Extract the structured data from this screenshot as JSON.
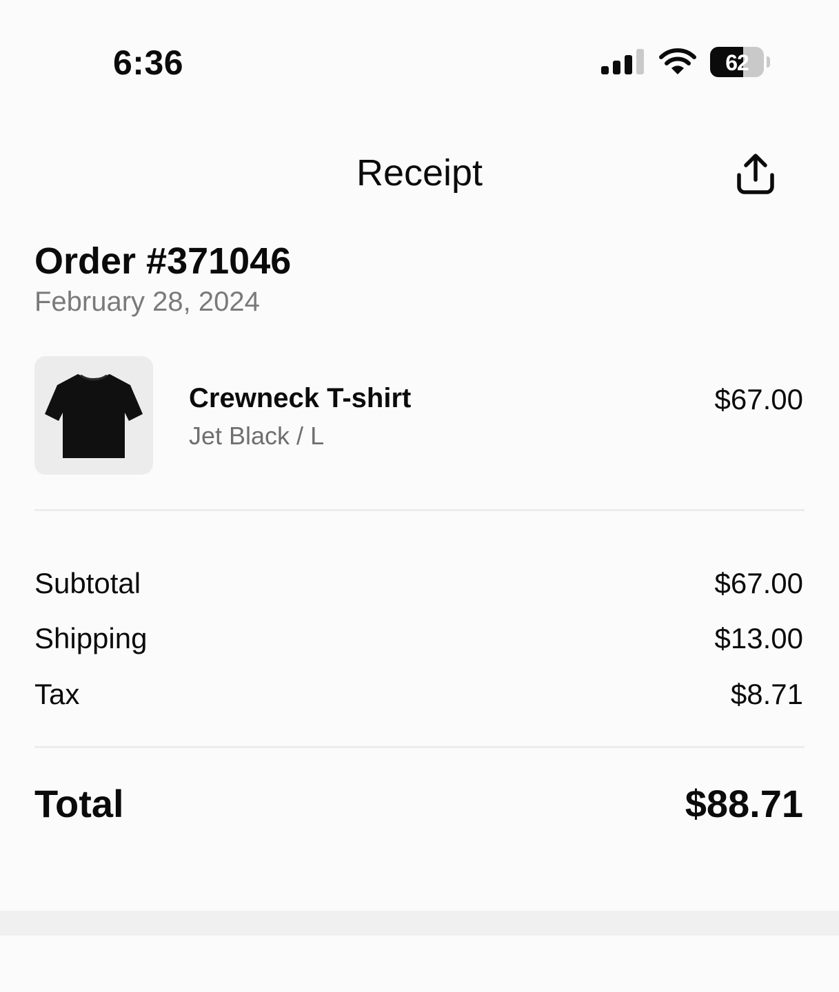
{
  "status_bar": {
    "time": "6:36",
    "battery_percent": "62",
    "battery_level": 0.62,
    "signal_bars": 3,
    "icons": [
      "signal-icon",
      "wifi-icon",
      "battery-icon"
    ]
  },
  "header": {
    "title": "Receipt",
    "share_icon": "share-icon"
  },
  "order": {
    "title": "Order #371046",
    "date": "February 28, 2024"
  },
  "items": [
    {
      "name": "Crewneck T-shirt",
      "variant": "Jet Black / L",
      "price": "$67.00",
      "image": "black-tshirt"
    }
  ],
  "summary": {
    "rows": [
      {
        "label": "Subtotal",
        "value": "$67.00"
      },
      {
        "label": "Shipping",
        "value": "$13.00"
      },
      {
        "label": "Tax",
        "value": "$8.71"
      }
    ],
    "total_label": "Total",
    "total_value": "$88.71"
  },
  "colors": {
    "background": "#fbfbfb",
    "text": "#0b0b0b",
    "secondary_text": "#7a7a7a",
    "divider": "#ececec"
  }
}
